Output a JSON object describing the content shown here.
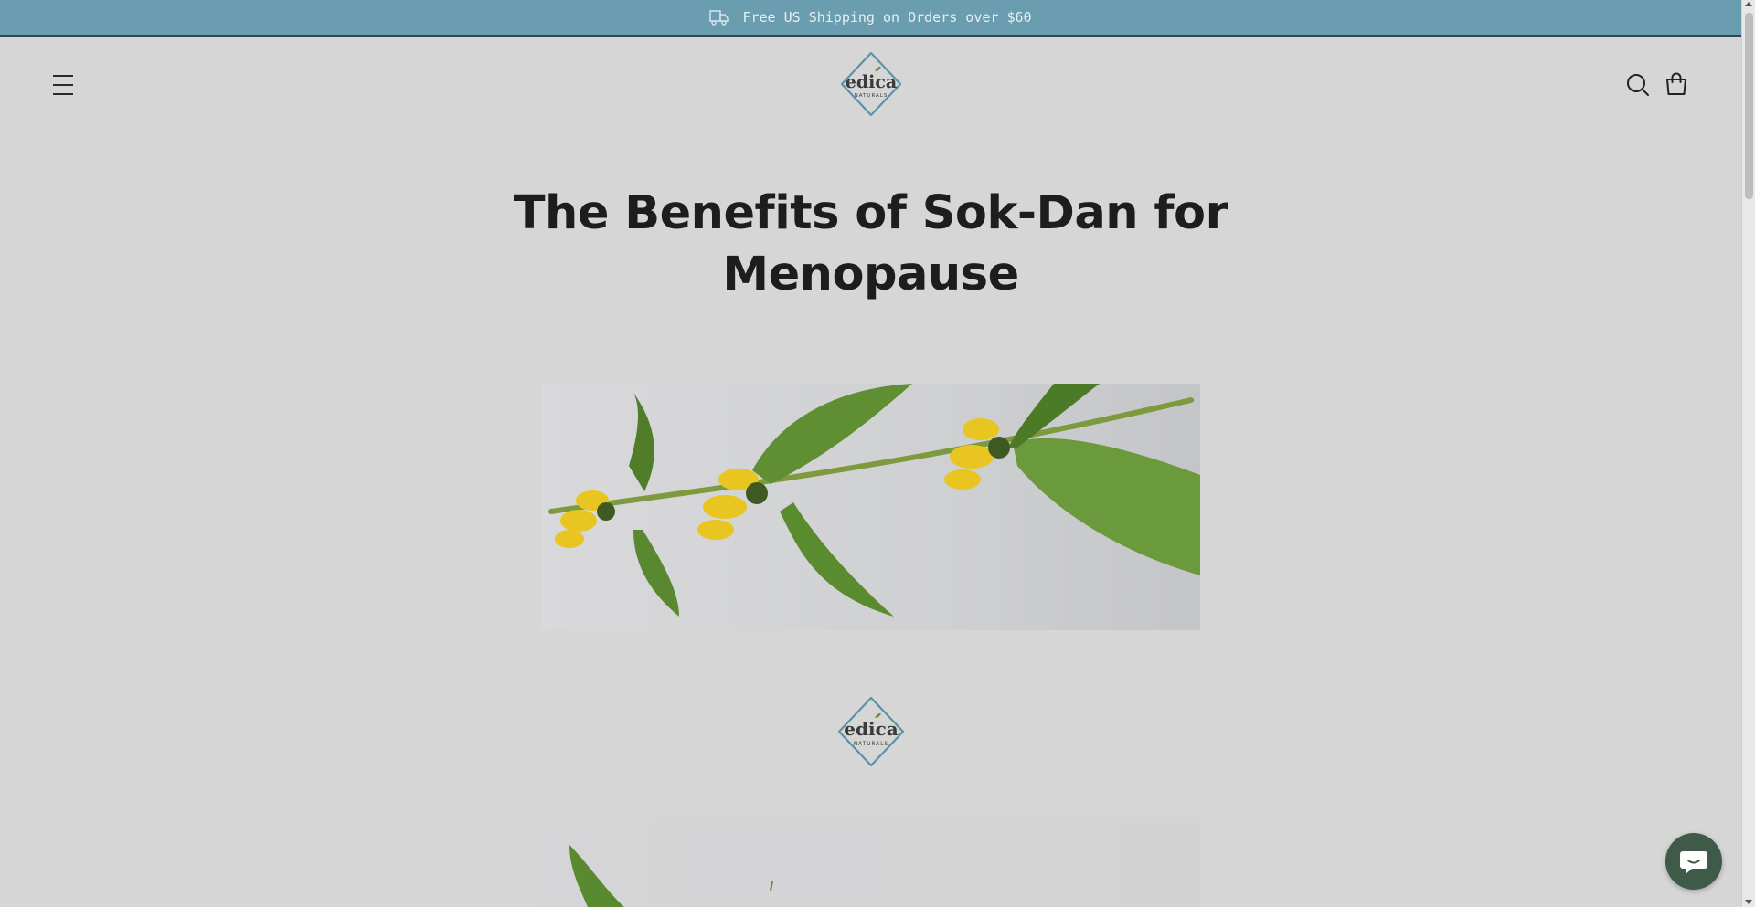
{
  "announcement": {
    "text": "Free US Shipping on Orders over $60",
    "icon": "truck-icon"
  },
  "header": {
    "menu_icon": "hamburger-menu-icon",
    "logo": {
      "brand": "edica",
      "tagline": "NATURALS"
    },
    "search_icon": "search-icon",
    "cart_icon": "shopping-bag-icon"
  },
  "article": {
    "title": "The Benefits of Sok-Dan for Menopause",
    "hero_image": "sok-dan-flower-image",
    "secondary_logo": {
      "brand": "edica",
      "tagline": "NATURALS"
    },
    "secondary_image": "sok-dan-leaf-image"
  },
  "chat": {
    "icon": "chat-bubble-icon"
  },
  "colors": {
    "announcement_bg": "#6a9daf",
    "page_bg": "#d6d6d6",
    "logo_teal": "#5a93a8",
    "chat_bg": "#3f5a48",
    "title_text": "#1d1d1d"
  }
}
